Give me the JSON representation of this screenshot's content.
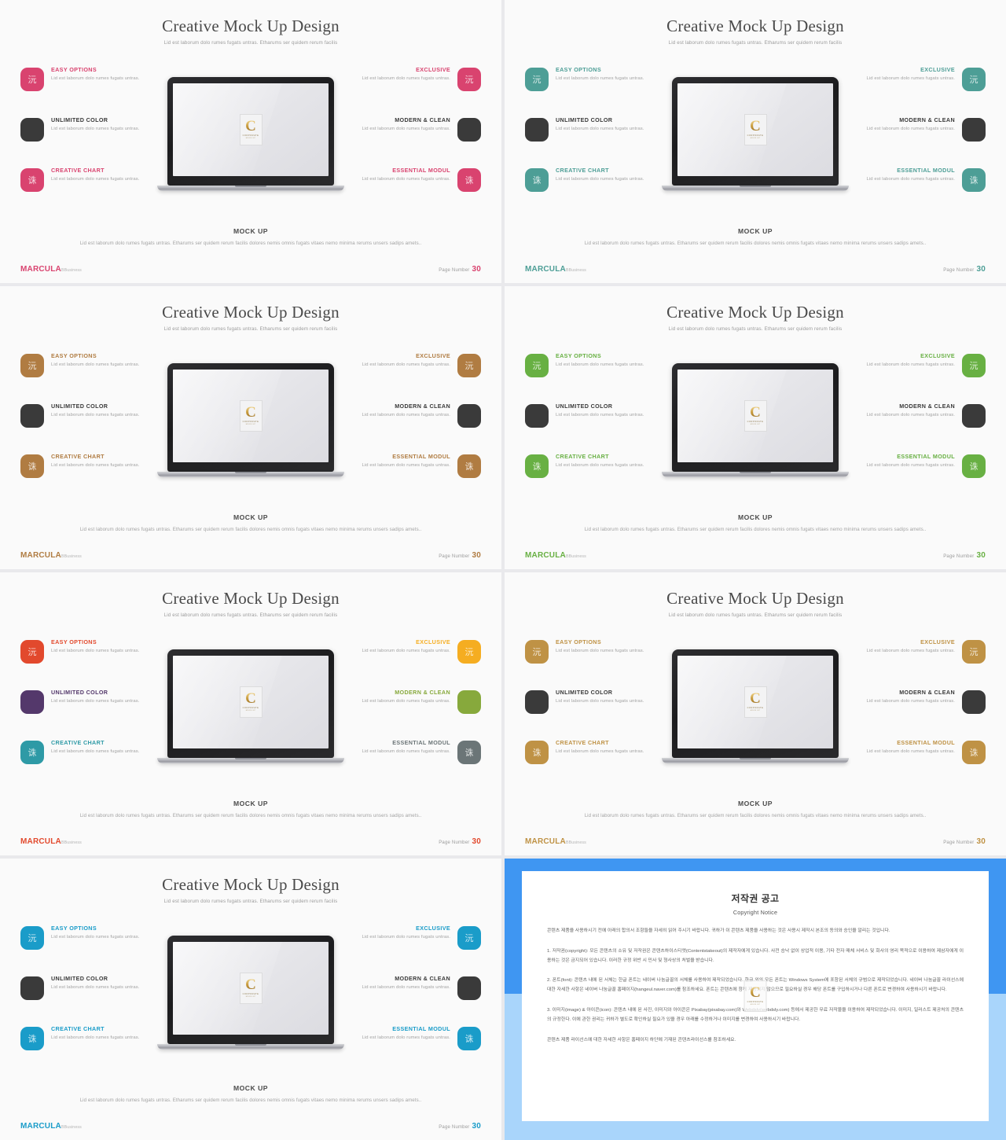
{
  "slide_common": {
    "title": "Creative Mock Up Design",
    "subtitle": "Lid est laborum dolo rumes fugats untras. Etharums ser quidem rerum facilis",
    "mock_heading": "MOCK UP",
    "mock_paragraph": "Lid est laborum dolo rumes fugats untras. Etharums ser quidem rerum facilis dolores nemis omnis fugats vitaes nemo minima rerums unsers sadips amets..",
    "feature_desc": "Lid est laborum dolo rumes fugats untras.",
    "features_left": [
      "EASY OPTIONS",
      "UNLIMITED COLOR",
      "CREATIVE CHART"
    ],
    "features_right": [
      "EXCLUSIVE",
      "MODERN & CLEAN",
      "ESSENTIAL MODUL"
    ],
    "badge_glyphs": [
      "沅",
      "",
      "诛"
    ],
    "brand_main": "MARCULA",
    "brand_sub": "BBusiness",
    "page_label": "Page Number",
    "page_number": "30",
    "logo": {
      "letter": "C",
      "line1": "CORPORATE",
      "line2": "MOCK  UP"
    },
    "dark": "#3a3a3a"
  },
  "slides": [
    {
      "id": "slide-pink",
      "accent": "#d9436f",
      "colors_left": [
        "#d9436f",
        "#3a3a3a",
        "#d9436f"
      ],
      "colors_right": [
        "#d9436f",
        "#3a3a3a",
        "#d9436f"
      ],
      "head_left": [
        "#d9436f",
        "#3a3a3a",
        "#d9436f"
      ],
      "head_right": [
        "#d9436f",
        "#3a3a3a",
        "#d9436f"
      ],
      "brand_color": "#d9436f",
      "page_color": "#d9436f"
    },
    {
      "id": "slide-teal",
      "accent": "#4d9e96",
      "colors_left": [
        "#4d9e96",
        "#3a3a3a",
        "#4d9e96"
      ],
      "colors_right": [
        "#4d9e96",
        "#3a3a3a",
        "#4d9e96"
      ],
      "head_left": [
        "#4d9e96",
        "#3a3a3a",
        "#4d9e96"
      ],
      "head_right": [
        "#4d9e96",
        "#3a3a3a",
        "#4d9e96"
      ],
      "brand_color": "#4d9e96",
      "page_color": "#4d9e96"
    },
    {
      "id": "slide-brown",
      "accent": "#b07c42",
      "colors_left": [
        "#b07c42",
        "#3a3a3a",
        "#b07c42"
      ],
      "colors_right": [
        "#b07c42",
        "#3a3a3a",
        "#b07c42"
      ],
      "head_left": [
        "#b07c42",
        "#3a3a3a",
        "#b07c42"
      ],
      "head_right": [
        "#b07c42",
        "#3a3a3a",
        "#b07c42"
      ],
      "brand_color": "#b07c42",
      "page_color": "#b07c42"
    },
    {
      "id": "slide-green",
      "accent": "#68b043",
      "colors_left": [
        "#68b043",
        "#3a3a3a",
        "#68b043"
      ],
      "colors_right": [
        "#68b043",
        "#3a3a3a",
        "#68b043"
      ],
      "head_left": [
        "#68b043",
        "#3a3a3a",
        "#68b043"
      ],
      "head_right": [
        "#68b043",
        "#3a3a3a",
        "#68b043"
      ],
      "brand_color": "#68b043",
      "page_color": "#68b043"
    },
    {
      "id": "slide-multicolor",
      "accent": "#e2492d",
      "colors_left": [
        "#e2492d",
        "#54386b",
        "#2e9aa6"
      ],
      "colors_right": [
        "#f5ad21",
        "#87a93c",
        "#6b7577"
      ],
      "head_left": [
        "#e2492d",
        "#54386b",
        "#2e9aa6"
      ],
      "head_right": [
        "#f5ad21",
        "#87a93c",
        "#6b7577"
      ],
      "brand_color": "#e2492d",
      "page_color": "#e2492d"
    },
    {
      "id": "slide-gold",
      "accent": "#bf9245",
      "colors_left": [
        "#bf9245",
        "#3a3a3a",
        "#bf9245"
      ],
      "colors_right": [
        "#bf9245",
        "#3a3a3a",
        "#bf9245"
      ],
      "head_left": [
        "#bf9245",
        "#3a3a3a",
        "#bf9245"
      ],
      "head_right": [
        "#bf9245",
        "#3a3a3a",
        "#bf9245"
      ],
      "brand_color": "#bf9245",
      "page_color": "#bf9245"
    },
    {
      "id": "slide-blue",
      "accent": "#1a9cc9",
      "colors_left": [
        "#1a9cc9",
        "#3a3a3a",
        "#1a9cc9"
      ],
      "colors_right": [
        "#1a9cc9",
        "#3a3a3a",
        "#1a9cc9"
      ],
      "head_left": [
        "#1a9cc9",
        "#3a3a3a",
        "#1a9cc9"
      ],
      "head_right": [
        "#1a9cc9",
        "#3a3a3a",
        "#1a9cc9"
      ],
      "brand_color": "#1a9cc9",
      "page_color": "#1a9cc9"
    }
  ],
  "copyright": {
    "heading": "저작권 공고",
    "subheading": "Copyright Notice",
    "intro": "콘텐츠 제품을 사용하시기 전에 아래의 합의서 조항들을 자세히 읽어 주시기 바랍니다. 귀하가 이 콘텐츠 제품을 사용하는 것은 사용시 제작시 본조의 동의와 승인을 알리는 것입니다.",
    "item1": "1. 저작권(copyright): 모든 콘텐츠의 소유 및 저작권은 콘텐츠하이스티앳(Contentstakeout)의 제작자에게 있습니다. 사전 승낙 없이 상업적 이용, 기타 전자 매체 서비스 및 회사의 영리 목적으로 이용하여 제삼자에게 이용하는 것은 금지되어 있습니다. 이러한 규정 위반 시 민사 및 형사상의 처벌을 받습니다.",
    "item2": "2. 폰트(font): 콘텐츠 내에 된 서체는 한글 폰트는 네이버 나눔글꼴의 서체를 사용하여 제작되었습니다. 한글 외의 모든 폰트는 Windows System에 포함된 서체의 규범으로 제작되었습니다. 네이버 나눔글꼴 라이선스에 대한 자세한 사항은 네이버 나눔글꼴 홈페이지(hangeul.naver.com)를 참조하세요. 폰트는 콘텐츠에 함께 제공되지 않으므로 필요하실 경우 해당 폰트를 구입하시거나 다른 폰트로 변경하여 사용하시기 바랍니다.",
    "item3": "3. 이미지(image) & 아이콘(icon): 콘텐츠 내에 된 사진, 이미지와 아이콘은 Pixabay(pixabay.com)와 Webdsly(webdsly.com) 등에서 제공한 무료 저작물을 이용하여 제작되었습니다. 이미지, 일러스트 제공처의 콘텐츠의 규정한다. 이에 관한 권리는 귀하가 별도로 확인하실 필요가 있을 경우 아래를 수정하거나 이미지를 변경하여 사용하시기 바랍니다.",
    "outro": "콘텐츠 제품 라이선스에 대한 자세한 사항은 홈페이지 하단에 기재된 콘텐츠라이선스를 참조하세요."
  }
}
